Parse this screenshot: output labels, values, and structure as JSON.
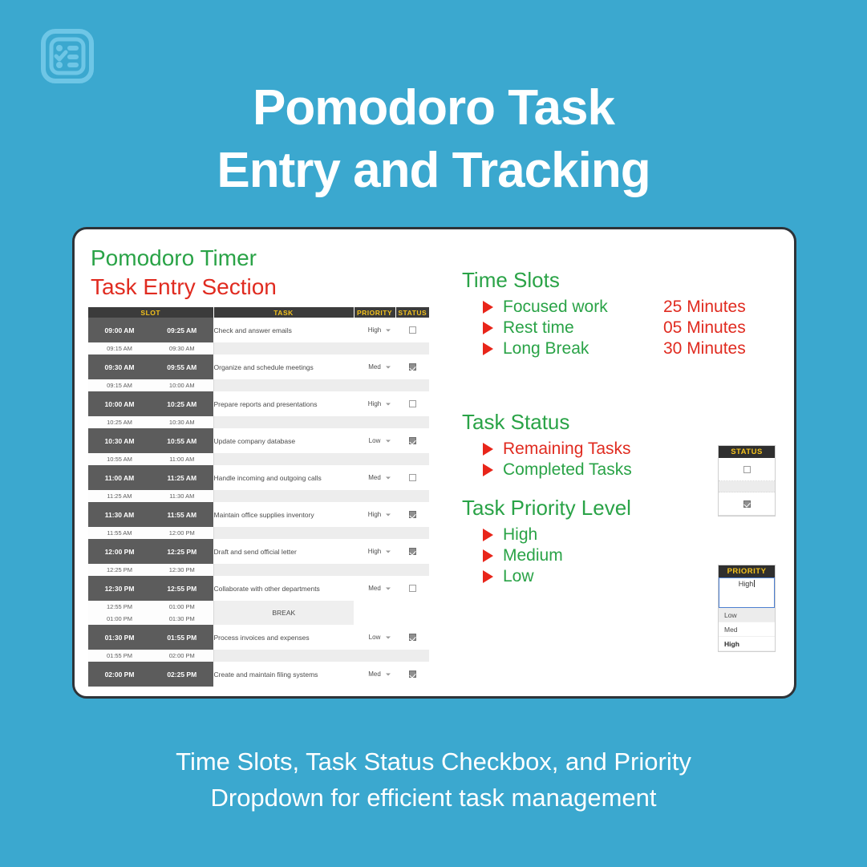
{
  "brand": {
    "logo_icon": "checklist-clipboard-icon",
    "background_color": "#3ba8cf",
    "title_line1": "Pomodoro Task",
    "title_line2": "Entry and Tracking"
  },
  "card": {
    "heading_green": "Pomodoro Timer",
    "heading_red": "Task Entry Section",
    "accent_green": "#2aa347",
    "accent_red": "#e02b20",
    "header_bg": "#3b3b3b",
    "header_text": "#f4c21c"
  },
  "sheet": {
    "columns": [
      "SLOT",
      "TASK",
      "PRIORITY",
      "STATUS"
    ],
    "break_label": "BREAK",
    "rows": [
      {
        "type": "task",
        "start": "09:00 AM",
        "end": "09:25 AM",
        "task": "Check and answer emails",
        "priority": "High",
        "status": false
      },
      {
        "type": "gap",
        "start": "09:15 AM",
        "end": "09:30 AM"
      },
      {
        "type": "task",
        "start": "09:30 AM",
        "end": "09:55 AM",
        "task": "Organize and schedule meetings",
        "priority": "Med",
        "status": true
      },
      {
        "type": "gap",
        "start": "09:15 AM",
        "end": "10:00 AM"
      },
      {
        "type": "task",
        "start": "10:00 AM",
        "end": "10:25 AM",
        "task": "Prepare reports and presentations",
        "priority": "High",
        "status": false
      },
      {
        "type": "gap",
        "start": "10:25 AM",
        "end": "10:30 AM"
      },
      {
        "type": "task",
        "start": "10:30 AM",
        "end": "10:55 AM",
        "task": "Update company database",
        "priority": "Low",
        "status": true
      },
      {
        "type": "gap",
        "start": "10:55 AM",
        "end": "11:00 AM"
      },
      {
        "type": "task",
        "start": "11:00 AM",
        "end": "11:25 AM",
        "task": "Handle incoming and outgoing calls",
        "priority": "Med",
        "status": false
      },
      {
        "type": "gap",
        "start": "11:25 AM",
        "end": "11:30 AM"
      },
      {
        "type": "task",
        "start": "11:30 AM",
        "end": "11:55 AM",
        "task": "Maintain office supplies inventory",
        "priority": "High",
        "status": true
      },
      {
        "type": "gap",
        "start": "11:55 AM",
        "end": "12:00 PM"
      },
      {
        "type": "task",
        "start": "12:00 PM",
        "end": "12:25 PM",
        "task": "Draft and send official letter",
        "priority": "High",
        "status": true
      },
      {
        "type": "gap",
        "start": "12:25 PM",
        "end": "12:30 PM"
      },
      {
        "type": "task",
        "start": "12:30 PM",
        "end": "12:55 PM",
        "task": "Collaborate with other departments",
        "priority": "Med",
        "status": false
      },
      {
        "type": "break1",
        "start": "12:55 PM",
        "end": "01:00 PM"
      },
      {
        "type": "break2",
        "start": "01:00 PM",
        "end": "01:30 PM"
      },
      {
        "type": "task",
        "start": "01:30 PM",
        "end": "01:55 PM",
        "task": "Process invoices and expenses",
        "priority": "Low",
        "status": true
      },
      {
        "type": "gap",
        "start": "01:55 PM",
        "end": "02:00 PM"
      },
      {
        "type": "task",
        "start": "02:00 PM",
        "end": "02:25 PM",
        "task": "Create and maintain filing systems",
        "priority": "Med",
        "status": true
      }
    ]
  },
  "time_slots": {
    "title": "Time Slots",
    "items": [
      {
        "label": "Focused work",
        "value": "25 Minutes"
      },
      {
        "label": "Rest time",
        "value": "05 Minutes"
      },
      {
        "label": "Long Break",
        "value": "30 Minutes"
      }
    ]
  },
  "task_status": {
    "title": "Task Status",
    "items": [
      {
        "label": "Remaining Tasks",
        "color": "red"
      },
      {
        "label": "Completed Tasks",
        "color": "green"
      }
    ],
    "widget": {
      "header": "STATUS",
      "unchecked": false,
      "checked": true
    }
  },
  "task_priority": {
    "title": "Task Priority Level",
    "items": [
      "High",
      "Medium",
      "Low"
    ],
    "widget": {
      "header": "PRIORITY",
      "value": "High",
      "options": [
        "Low",
        "Med",
        "High"
      ],
      "highlighted_option": "Low"
    }
  },
  "caption": {
    "line1": "Time Slots, Task Status Checkbox, and Priority",
    "line2": "Dropdown for efficient task management"
  }
}
